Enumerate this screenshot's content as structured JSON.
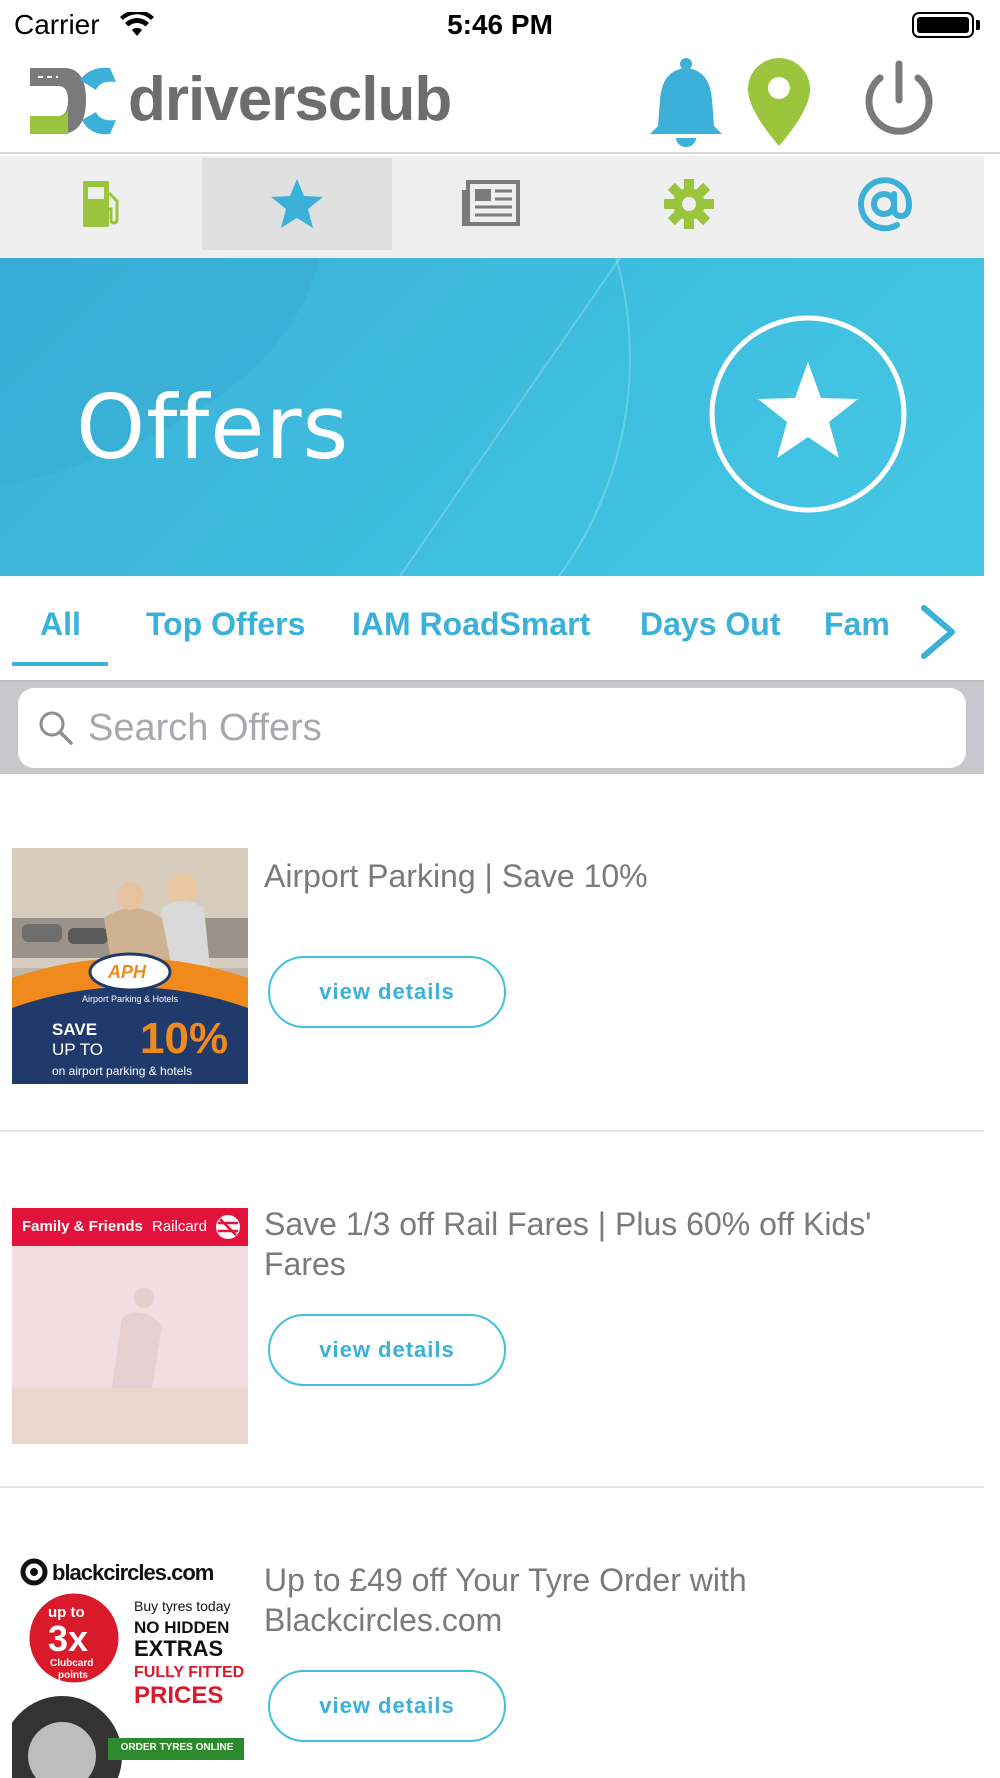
{
  "status_bar": {
    "carrier": "Carrier",
    "time": "5:46 PM"
  },
  "header": {
    "logo_text": "driversclub"
  },
  "nav": {
    "items": [
      {
        "icon": "fuel-pump-icon",
        "color": "#9bc53d"
      },
      {
        "icon": "star-icon",
        "color": "#3bb0d8",
        "active": true
      },
      {
        "icon": "newspaper-icon",
        "color": "#7a7a7a"
      },
      {
        "icon": "gear-icon",
        "color": "#9bc53d"
      },
      {
        "icon": "at-sign-icon",
        "color": "#3bb0d8"
      }
    ]
  },
  "banner": {
    "title": "Offers",
    "icon": "star-icon"
  },
  "tabs": {
    "items": [
      "All",
      "Top Offers",
      "IAM RoadSmart",
      "Days Out",
      "Fam"
    ],
    "selected": "All"
  },
  "search": {
    "placeholder": "Search Offers",
    "value": ""
  },
  "offers": [
    {
      "title": "Airport Parking | Save 10%",
      "button": "view details",
      "image": {
        "brand": "APH",
        "brand_sub": "Airport Parking & Hotels",
        "line1": "SAVE",
        "line2": "UP TO",
        "big": "10%",
        "footer": "on airport parking & hotels"
      }
    },
    {
      "title": "Save 1/3 off Rail Fares | Plus 60% off Kids' Fares",
      "button": "view details",
      "image": {
        "header_a": "Family & Friends",
        "header_b": "Railcard"
      }
    },
    {
      "title": "Up to £49 off Your Tyre Order with Blackcircles.com",
      "button": "view details",
      "image": {
        "brand": "blackcircles.com",
        "badge_top": "up to",
        "badge_big": "3x",
        "badge_sub1": "Clubcard",
        "badge_sub2": "points",
        "line1": "Buy tyres today",
        "line2": "NO HIDDEN",
        "line3": "EXTRAS",
        "line4": "FULLY FITTED",
        "line5": "PRICES",
        "cta": "ORDER TYRES ONLINE"
      }
    }
  ],
  "colors": {
    "accent": "#3bb0d8",
    "green": "#9bc53d",
    "banner": "#3fbfe0"
  }
}
